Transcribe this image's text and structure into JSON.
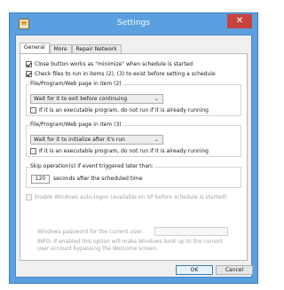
{
  "window": {
    "title": "Settings",
    "close_glyph": "✕",
    "app_icon": "app-icon"
  },
  "tabs": [
    {
      "label": "General",
      "active": true
    },
    {
      "label": "More",
      "active": false
    },
    {
      "label": "Repair Network",
      "active": false
    }
  ],
  "general": {
    "close_minimize": {
      "label": "Close button works as \"minimize\" when schedule is started",
      "checked": true
    },
    "check_files": {
      "label": "Check files to run in items (2), (3) to exist before setting a schedule",
      "checked": true
    },
    "item2": {
      "group_label": "File/Program/Web page in item (2)",
      "select_value": "Wait for it to exit before continuing",
      "not_run_label": "If it is an executable program, do not run if it is already running",
      "not_run_checked": false
    },
    "item3": {
      "group_label": "File/Program/Web page in item (3)",
      "select_value": "Wait for it to initialize after it's run",
      "not_run_label": "If it is an executable program, do not run if it is already running",
      "not_run_checked": false
    },
    "skip": {
      "group_label": "Skip operation(s) if event triggered later than:",
      "seconds_value": "120",
      "seconds_label": "seconds after the scheduled time"
    },
    "autologon": {
      "label": "Enable Windows auto-logon (available on XP before schedule is started)",
      "checked": false,
      "enabled": false,
      "password_label": "Windows password for the current user:",
      "password_value": "",
      "info": "INFO: If enabled this option will make Windows boot up to the current user account bypassing the Welcome screen."
    }
  },
  "buttons": {
    "ok": "OK",
    "cancel": "Cancel"
  },
  "colors": {
    "title_bar": "#5a9fe0",
    "close_button": "#c8423e",
    "client_background": "#f0f0f0"
  }
}
